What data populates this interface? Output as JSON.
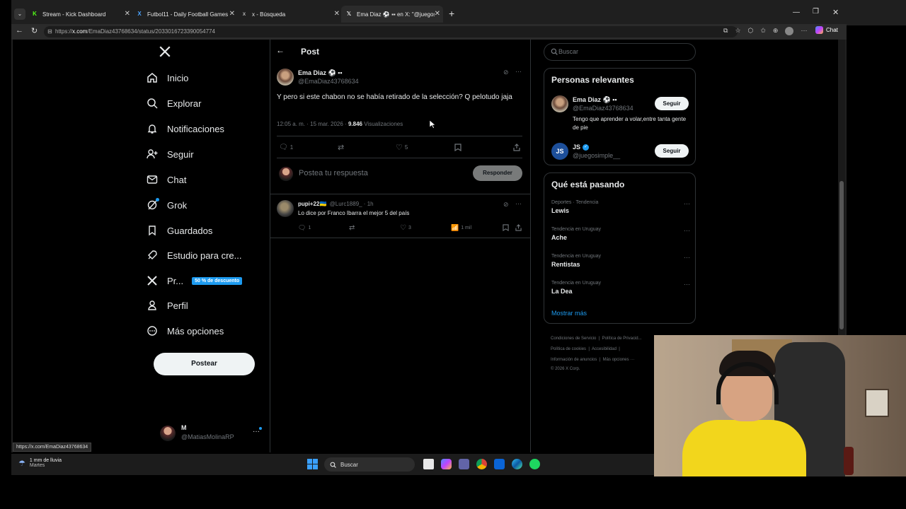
{
  "browser": {
    "tabs": [
      {
        "title": "Stream - Kick Dashboard"
      },
      {
        "title": "Futbol11 - Daily Football Games"
      },
      {
        "title": "x - Búsqueda"
      },
      {
        "title": "Ema Diaz ⚽ ▪▪ en X: \"@juegosim"
      }
    ],
    "url_prefix": "https://",
    "url_domain": "x.com",
    "url_path": "/EmaDiaz43768634/status/2033016723390054774",
    "chat_label": "Chat",
    "status_url": "https://x.com/EmaDiaz43768634"
  },
  "sidebar": {
    "items": [
      {
        "label": "Inicio"
      },
      {
        "label": "Explorar"
      },
      {
        "label": "Notificaciones"
      },
      {
        "label": "Seguir"
      },
      {
        "label": "Chat"
      },
      {
        "label": "Grok"
      },
      {
        "label": "Guardados"
      },
      {
        "label": "Estudio para cre..."
      },
      {
        "label": "Pr...",
        "badge": "50 % de descuento"
      },
      {
        "label": "Perfil"
      },
      {
        "label": "Más opciones"
      }
    ],
    "post_button": "Postear",
    "account": {
      "name": "M",
      "handle": "@MatiasMolinaRP"
    }
  },
  "main": {
    "header_title": "Post",
    "post": {
      "author": "Ema Diaz ⚽ ▪▪",
      "handle": "@EmaDiaz43768634",
      "text": "Y pero si este chabon no se había retirado de la selección? Q pelotudo jaja",
      "time": "12:05 a. m. · 15 mar. 2026 ·",
      "views_count": "9.846",
      "views_label": "Visualizaciones",
      "replies": "1",
      "likes": "5"
    },
    "reply_placeholder": "Postea tu respuesta",
    "reply_button": "Responder",
    "reply": {
      "author": "pupi+22🇺🇦",
      "handle_time": "@Lurc1889_ · 1h",
      "text": "Lo dice por Franco Ibarra el mejor 5 del país",
      "replies": "1",
      "likes": "3",
      "views": "1 mil"
    }
  },
  "right": {
    "search_placeholder": "Buscar",
    "relevant_title": "Personas relevantes",
    "people": [
      {
        "name": "Ema Diaz ⚽ ▪▪",
        "handle": "@EmaDiaz43768634",
        "bio": "Tengo que aprender a volar,entre tanta gente de pie",
        "button": "Seguir"
      },
      {
        "name": "JS",
        "handle": "@juegosimple__",
        "bio": "",
        "button": "Seguir"
      }
    ],
    "trending_title": "Qué está pasando",
    "trends": [
      {
        "category": "Deportes · Tendencia",
        "name": "Lewis"
      },
      {
        "category": "Tendencia en Uruguay",
        "name": "Ache"
      },
      {
        "category": "Tendencia en Uruguay",
        "name": "Rentistas"
      },
      {
        "category": "Tendencia en Uruguay",
        "name": "La Dea"
      }
    ],
    "show_more": "Mostrar más",
    "footer": {
      "line1a": "Condiciones de Servicio",
      "line1b": "Política de Privacid...",
      "line2a": "Política de cookies",
      "line2b": "Accesibilidad",
      "line3a": "Información de anuncios",
      "line3b": "Más opciones ···",
      "line4": "© 2026 X Corp."
    }
  },
  "taskbar": {
    "weather_line1": "1 mm de lluvia",
    "weather_line2": "Martes",
    "search_label": "Buscar"
  },
  "colors": {
    "accent": "#1d9bf0",
    "badge": "#1d9bf0",
    "bg": "#000000",
    "border": "#2f3336"
  }
}
